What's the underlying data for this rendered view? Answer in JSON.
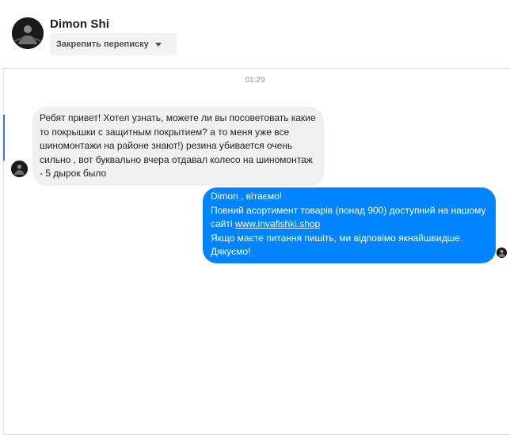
{
  "contact": {
    "name": "Dimon Shi"
  },
  "pin_button": {
    "label": "Закрепить переписку"
  },
  "thread": {
    "timestamp": "01:29",
    "incoming": {
      "text": "Ребят привет! Хотел узнать, можете ли вы посоветовать какие то покрышки с защитным покрытием? а то меня уже все шиномонтажи на районе знают!) резина убивается очень сильно , вот буквально вчера отдавал колесо на шиномонтаж - 5 дырок было"
    },
    "outgoing": {
      "line1": "Dimon , вітаємо!",
      "line2": "Повний асортимент товарів (понад 900) доступний на нашому",
      "line3_prefix": "сайті ",
      "link": "www.invafishki.shop",
      "line4": "Якщо маєте питання пишіть, ми відповімо якнайшвидше.",
      "line5": "Дякуємо!"
    }
  },
  "colors": {
    "outgoing_bubble": "#0084ff",
    "incoming_bubble": "#f1f0f0",
    "accent": "#3578e5"
  },
  "icons": {
    "dropdown": "chevron-down-icon",
    "avatar": "user-avatar"
  }
}
